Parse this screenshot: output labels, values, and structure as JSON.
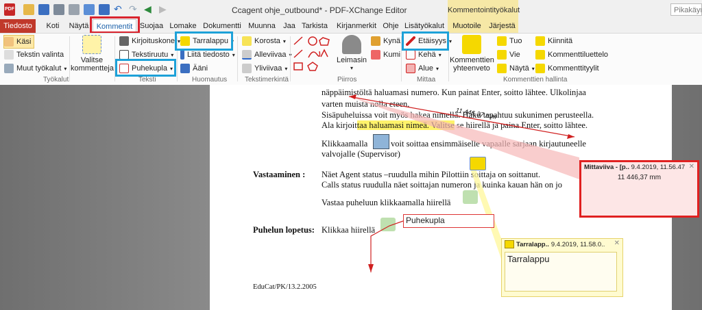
{
  "app": {
    "title": "Ccagent ohje_outbound* - PDF-XChange Editor",
    "icon_text": "PDF",
    "context_group_label": "Kommentointityökalut",
    "search_placeholder": "Pikakäynnistys"
  },
  "tabs": [
    {
      "label": "Tiedosto"
    },
    {
      "label": "Koti"
    },
    {
      "label": "Näytä"
    },
    {
      "label": "Kommentit"
    },
    {
      "label": "Suojaa"
    },
    {
      "label": "Lomake"
    },
    {
      "label": "Dokumentti"
    },
    {
      "label": "Muunna"
    },
    {
      "label": "Jaa"
    },
    {
      "label": "Tarkista"
    },
    {
      "label": "Kirjanmerkit"
    },
    {
      "label": "Ohje"
    },
    {
      "label": "Lisätyökalut"
    },
    {
      "label": "Muotoile"
    },
    {
      "label": "Järjestä"
    }
  ],
  "ribbon": {
    "tools": {
      "hand": "Käsi",
      "text_select": "Tekstin valinta",
      "other_tools": "Muut työkalut",
      "group": "Työkalut"
    },
    "select_comments": "Valitse kommentteja",
    "text": {
      "typewriter": "Kirjoituskone",
      "textbox": "Tekstiruutu",
      "callout": "Puhekupla",
      "group": "Teksti"
    },
    "note": {
      "sticky": "Tarralappu",
      "attach": "Liitä tiedosto",
      "sound": "Ääni",
      "group": "Huomautus"
    },
    "markup": {
      "highlight": "Korosta",
      "underline": "Alleviivaa",
      "strikeout": "Yliviivaa",
      "group": "Tekstimerkintä"
    },
    "drawing": {
      "stamp": "Leimasin",
      "pencil": "Kynä",
      "eraser": "Kumi",
      "group": "Piirros"
    },
    "measure": {
      "distance": "Etäisyys",
      "perimeter": "Kehä",
      "area": "Alue",
      "group": "Mittaa"
    },
    "manage": {
      "summary": "Kommenttien yhteenveto",
      "import": "Tuo",
      "export": "Vie",
      "show": "Näytä",
      "pin": "Kiinnitä",
      "list": "Kommenttiluettelo",
      "styles": "Kommenttityylit",
      "group": "Kommenttien hallinta"
    }
  },
  "document": {
    "lines": [
      "näppäimistöltä haluamasi numero. Kun painat Enter, soitto lähtee. Ulkolinjaa",
      "varten muista nolla eteen.",
      "Sisäpuheluissa voit myös hakea nimellä. Haku tapahtuu sukunimen perusteella.",
      "Ala kirjoittaa haluamasi nimeä. Valitse se hiirellä ja paina Enter, soitto lähtee.",
      "Klikkaamalla",
      "voit soittaa ensimmäiselle vapaalle sarjaan kirjautuneelle",
      "valvojalle (Supervisor)"
    ],
    "line4_pre": "Ala kirjoit",
    "line4_hl": "taa haluamasi nimeä. Valitse",
    "line4_post": " se hiirellä ja paina Enter, soitto lähtee.",
    "answer_label": "Vastaaminen :",
    "answer_lines": [
      "Näet Agent status –ruudulla mihin Pilottiin soittaja on soittanut.",
      "Calls status ruudulla näet soittajan numeron ja kuinka kauan hän on jo",
      "Vastaa puheluun klikkaamalla hiirellä"
    ],
    "end_label": "Puhelun lopetus:",
    "end_text": "Klikkaa hiirellä",
    "footer": "EduCat/PK/13.2.2005",
    "measurement_label": "11 446,37 mm"
  },
  "annotations": {
    "measure_popup": {
      "author": "Mittaviiva - [p..",
      "date": "9.4.2019, 11.56.47",
      "body": "11 446,37 mm"
    },
    "note_popup": {
      "author": "Tarralapp..",
      "date": "9.4.2019, 11.58.0..",
      "body": "Tarralappu"
    },
    "callout_text": "Puhekupla"
  },
  "colors": {
    "accent_red": "#d9232d",
    "accent_blue": "#1da1d8",
    "tab_active_text": "#1a5fa8"
  }
}
